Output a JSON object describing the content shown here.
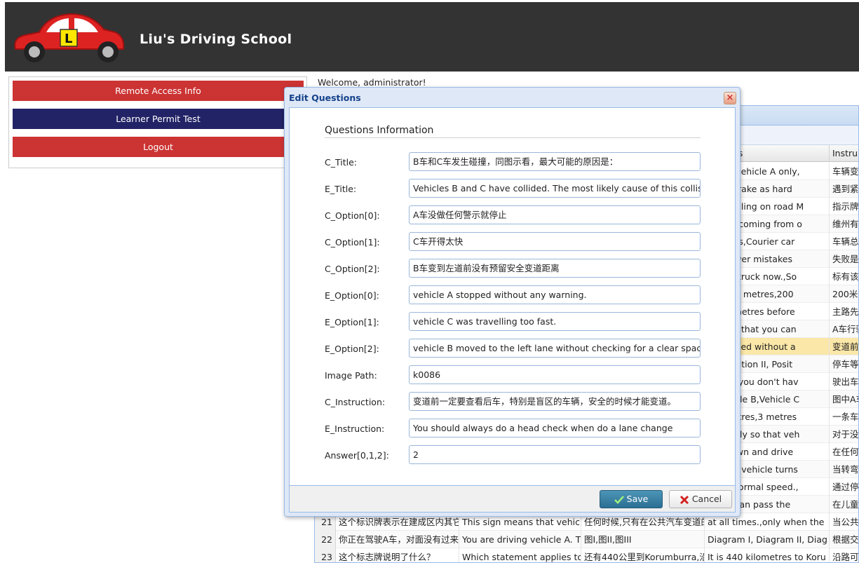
{
  "app": {
    "title": "Liu's Driving School",
    "logo_letter": "L"
  },
  "nav": {
    "remote": "Remote Access Info",
    "permit": "Learner Permit Test",
    "logout": "Logout",
    "colors": {
      "red": "#cc3333",
      "navy": "#222266"
    }
  },
  "welcome": "Welcome, administrator!",
  "grid": {
    "headers": [
      "ns",
      "Instru"
    ],
    "rows": [
      {
        "e_opt": "ver of vehicle A only,",
        "instr": "车辆变"
      },
      {
        "e_opt": "ately brake as hard",
        "instr": "遇到紧"
      },
      {
        "e_opt": "e travelling on road M",
        "instr": "指示牌"
      },
      {
        "e_opt": " will be coming from o",
        "instr": "维州有"
      },
      {
        "e_opt": "ger cars,Courier car",
        "instr": "车辆总"
      },
      {
        "e_opt": "ake fewer mistakes",
        "instr": "失败是"
      },
      {
        "e_opt": "ke the truck now.,So",
        "instr": "标有该"
      },
      {
        "e_opt": "res,100 metres,200",
        "instr": "200米"
      },
      {
        "e_opt": "or 30 metres before",
        "instr": "主路先"
      },
      {
        "e_opt": "own so that you can",
        "instr": "A车行驶"
      },
      {
        "e_opt": " A stopped without a",
        "instr": "变道前"
      },
      {
        "e_opt": "n I, Position II, Posit",
        "instr": "停车等"
      },
      {
        "e_opt": ",When you don't hav",
        "instr": "驶出车"
      },
      {
        "e_opt": " A,Vehicle B,Vehicle C",
        "instr": "图中A车"
      },
      {
        "e_opt": "e,2 metres,3 metres",
        "instr": "一条车"
      },
      {
        "e_opt": "ff quickly so that veh",
        "instr": "对于没"
      },
      {
        "e_opt": "low down and drive",
        "instr": "在任何"
      },
      {
        "e_opt": "ntil the vehicle turns",
        "instr": "当转弯"
      },
      {
        "e_opt": "ue at normal speed.,",
        "instr": "通过停"
      },
      {
        "e_opt": "e you can pass the",
        "instr": "在儿童"
      }
    ],
    "visible_rows": [
      {
        "num": "21",
        "c_title": "这个标识牌表示在建成区内其它",
        "e_title": "This sign means that vehicl",
        "c_opt": "任何时候,只有在公共汽车变道的",
        "e_opt": "at all times.,only when the",
        "instr": "当公共"
      },
      {
        "num": "22",
        "c_title": "你正在驾驶A车，对面没有过来的",
        "e_title": "You are driving vehicle A. Th",
        "c_opt": "图I,图II,图III",
        "e_opt": "Diagram I, Diagram II, Diag",
        "instr": "根据交"
      },
      {
        "num": "23",
        "c_title": "这个标志牌说明了什么？",
        "e_title": "Which statement applies to",
        "c_opt": "还有440公里到Korumburra,沿",
        "e_opt": "It is 440 kilometres to Koru",
        "instr": "沿路可"
      }
    ]
  },
  "dialog": {
    "title": "Edit Questions",
    "section": "Questions Information",
    "fields": [
      {
        "label": "C_Title:",
        "value": "B车和C车发生碰撞，同图示看，最大可能的原因是："
      },
      {
        "label": "E_Title:",
        "value": "Vehicles B and C have collided. The most likely cause of this collis"
      },
      {
        "label": "C_Option[0]:",
        "value": "A车没做任何警示就停止"
      },
      {
        "label": "C_Option[1]:",
        "value": "C车开得太快"
      },
      {
        "label": "C_Option[2]:",
        "value": "B车变到左道前没有预留安全变道距离"
      },
      {
        "label": "E_Option[0]:",
        "value": "vehicle A stopped without any warning."
      },
      {
        "label": "E_Option[1]:",
        "value": "vehicle C was travelling too fast."
      },
      {
        "label": "E_Option[2]:",
        "value": "vehicle B moved to the left lane without checking for a clear spac"
      },
      {
        "label": "Image Path:",
        "value": "k0086"
      },
      {
        "label": "C_Instruction:",
        "value": "变道前一定要查看后车，特别是盲区的车辆，安全的时候才能变道。"
      },
      {
        "label": "E_Instruction:",
        "value": "You should always do a head check when do a lane change"
      },
      {
        "label": "Answer[0,1,2]:",
        "value": "2"
      }
    ],
    "save": "Save",
    "cancel": "Cancel",
    "close_icon": "×"
  }
}
